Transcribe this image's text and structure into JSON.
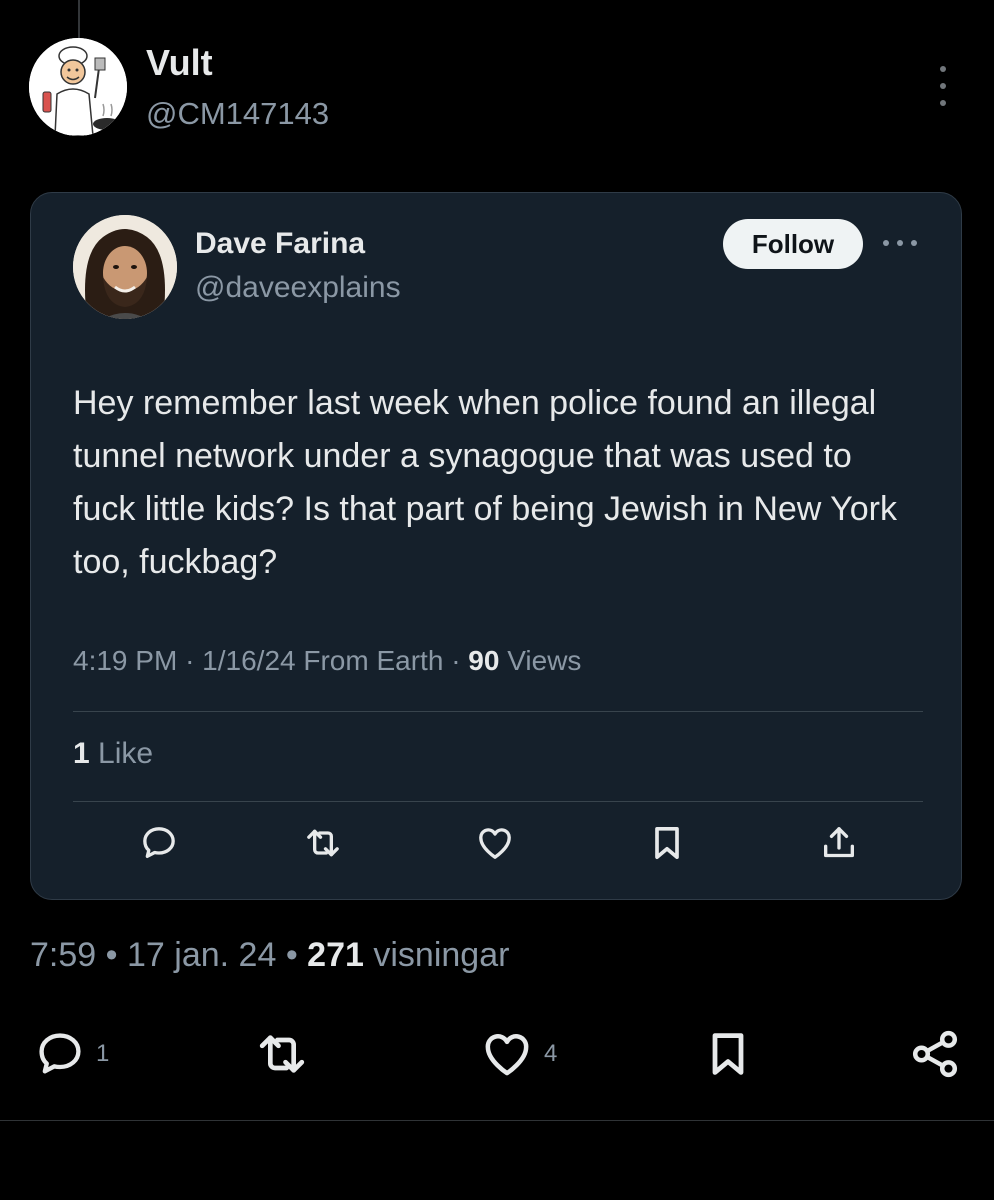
{
  "outer_tweet": {
    "author_name": "Vult",
    "author_handle": "@CM147143",
    "time": "7:59",
    "date": "17 jan. 24",
    "views_count": "271",
    "views_label": "visningar",
    "reply_count": "1",
    "like_count": "4",
    "avatar_icon": "chef-cartoon-avatar",
    "more_icon": "vertical-ellipsis-icon"
  },
  "quoted_tweet": {
    "author_name": "Dave Farina",
    "author_handle": "@daveexplains",
    "follow_label": "Follow",
    "text": "Hey remember last week when police found an illegal tunnel network under a synagogue that was used to fuck little kids? Is that part of being Jewish in New York too, fuckbag?",
    "time": "4:19 PM",
    "date": "1/16/24",
    "source": "From Earth",
    "views_count": "90",
    "views_label": "Views",
    "likes_count": "1",
    "likes_label": "Like",
    "avatar_icon": "portrait-photo-avatar",
    "more_icon": "horizontal-ellipsis-icon"
  },
  "colors": {
    "background": "#000000",
    "card_background": "#15202b",
    "primary_text": "#e7e9ea",
    "secondary_text": "#8b98a5",
    "follow_button_bg": "#eff3f4"
  }
}
